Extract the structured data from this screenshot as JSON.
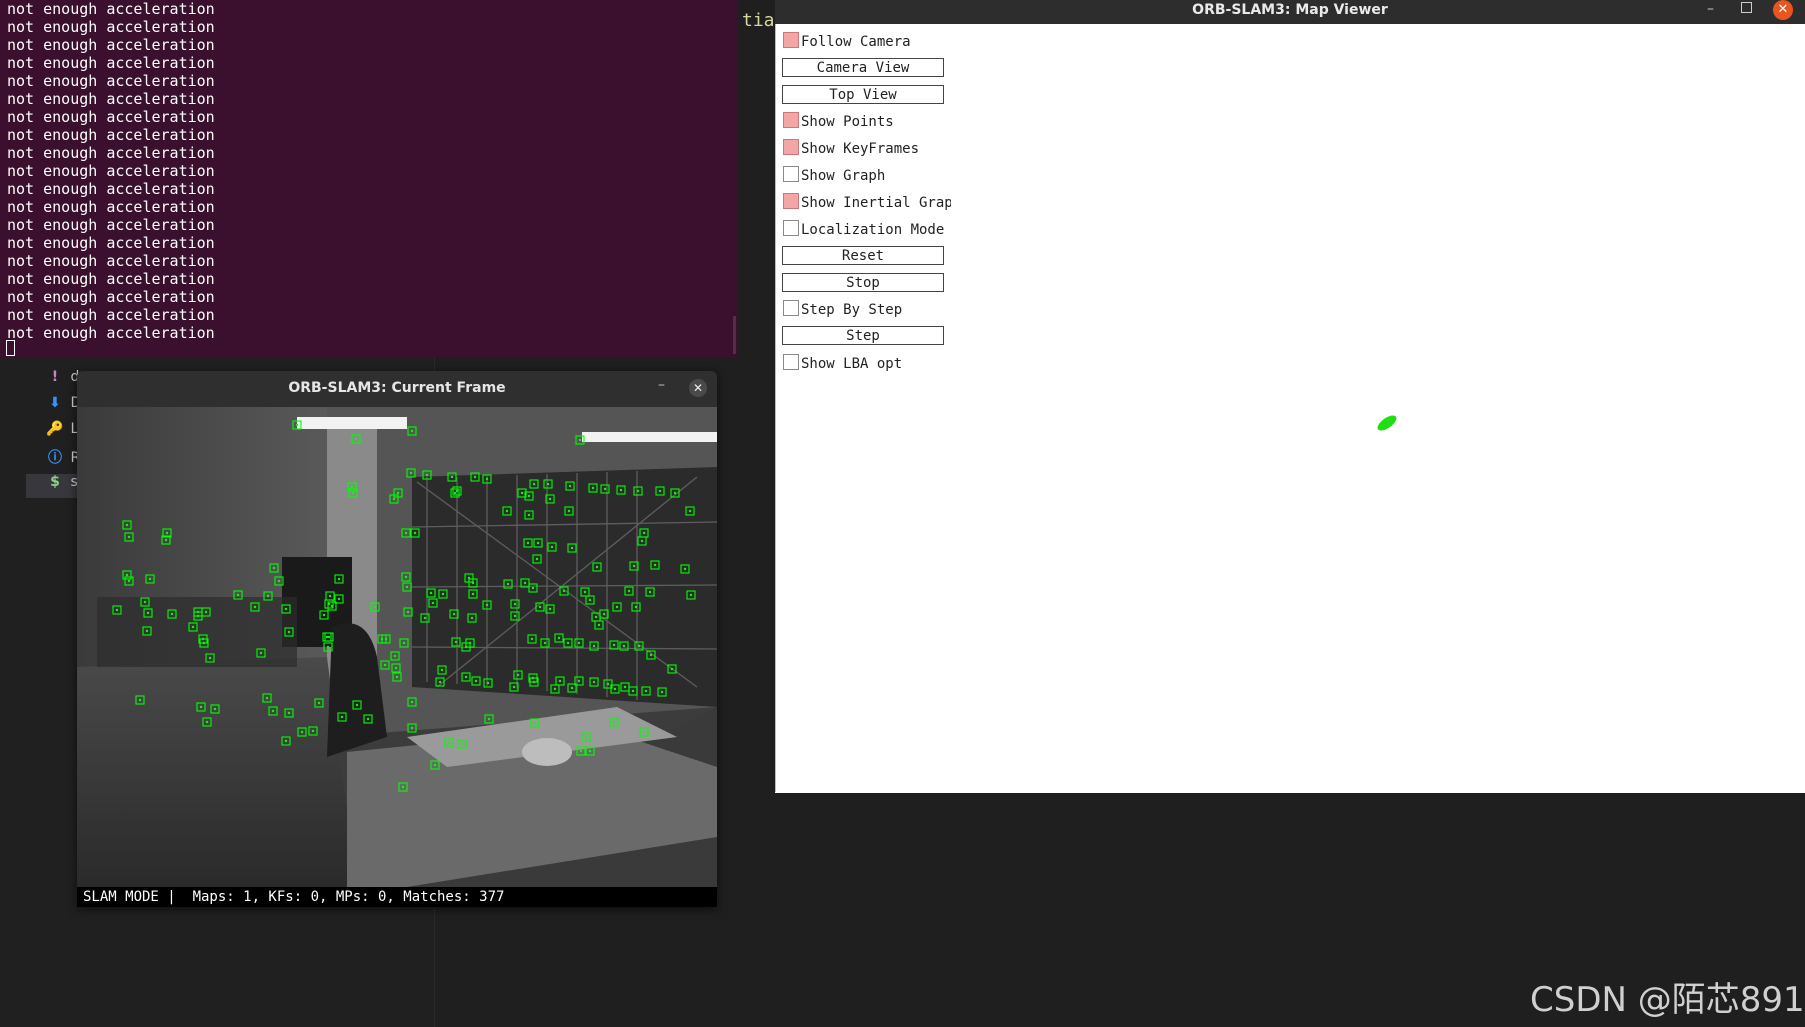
{
  "terminal": {
    "lines": [
      "not enough acceleration",
      "not enough acceleration",
      "not enough acceleration",
      "not enough acceleration",
      "not enough acceleration",
      "not enough acceleration",
      "not enough acceleration",
      "not enough acceleration",
      "not enough acceleration",
      "not enough acceleration",
      "not enough acceleration",
      "not enough acceleration",
      "not enough acceleration",
      "not enough acceleration",
      "not enough acceleration",
      "not enough acceleration",
      "not enough acceleration",
      "not enough acceleration",
      "not enough acceleration"
    ],
    "bg_color": "#3b0f2e"
  },
  "editor": {
    "right_text": "tia",
    "explorer_items": [
      {
        "icon": "!",
        "icon_name": "exclamation-icon",
        "label": "d",
        "color": "#c586c0"
      },
      {
        "icon": "⬇",
        "icon_name": "download-icon",
        "label": "D",
        "color": "#3794ff"
      },
      {
        "icon": "🔑",
        "icon_name": "key-icon",
        "label": "Li",
        "color": "#e2c08d"
      },
      {
        "icon": "ⓘ",
        "icon_name": "info-icon",
        "label": "R",
        "color": "#3794ff"
      },
      {
        "icon": "$",
        "icon_name": "dollar-icon",
        "label": "sl",
        "color": "#89d185"
      }
    ]
  },
  "current_frame": {
    "title": "ORB-SLAM3: Current Frame",
    "status": "SLAM MODE |  Maps: 1, KFs: 0, MPs: 0, Matches: 377",
    "feature_color": "#00ff00"
  },
  "map_viewer": {
    "title": "ORB-SLAM3: Map Viewer",
    "controls": [
      {
        "type": "checkbox",
        "label": "Follow Camera",
        "checked": true
      },
      {
        "type": "button",
        "label": "Camera View"
      },
      {
        "type": "button",
        "label": "Top View"
      },
      {
        "type": "checkbox",
        "label": "Show Points",
        "checked": true
      },
      {
        "type": "checkbox",
        "label": "Show KeyFrames",
        "checked": true
      },
      {
        "type": "checkbox",
        "label": "Show Graph",
        "checked": false
      },
      {
        "type": "checkbox",
        "label": "Show Inertial Graph",
        "checked": true
      },
      {
        "type": "checkbox",
        "label": "Localization Mode",
        "checked": false
      },
      {
        "type": "button",
        "label": "Reset"
      },
      {
        "type": "button",
        "label": "Stop"
      },
      {
        "type": "checkbox",
        "label": "Step By Step",
        "checked": false
      },
      {
        "type": "button",
        "label": "Step"
      },
      {
        "type": "checkbox",
        "label": "Show LBA opt",
        "checked": false
      }
    ],
    "map_color": "#22dd11"
  },
  "watermark": "CSDN @陌芯891"
}
